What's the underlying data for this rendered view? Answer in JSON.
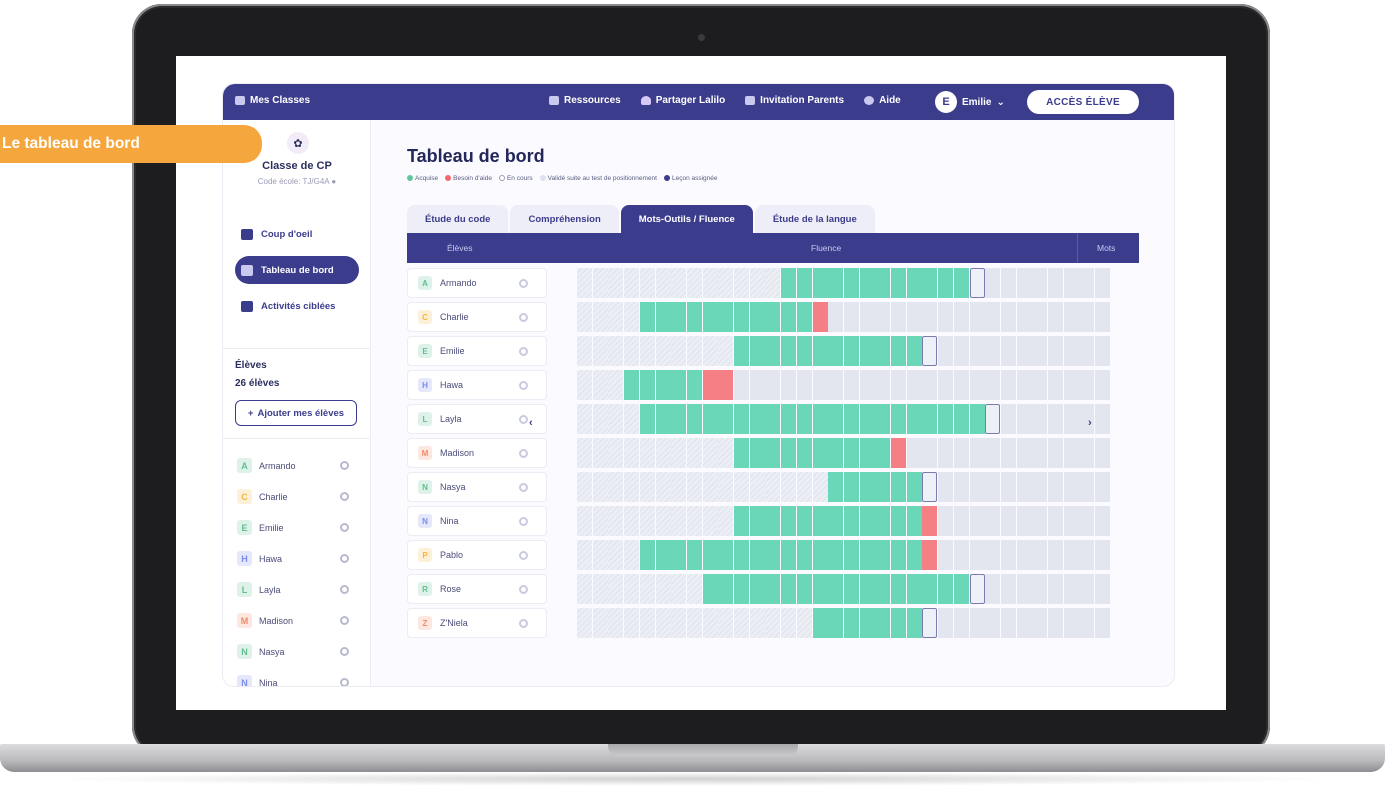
{
  "callout": {
    "text": "Le tableau de bord"
  },
  "topbar": {
    "mes_classes": "Mes Classes",
    "nav": [
      {
        "label": "Ressources",
        "icon": "book-icon"
      },
      {
        "label": "Partager Lalilo",
        "icon": "heart-icon"
      },
      {
        "label": "Invitation Parents",
        "icon": "mail-icon"
      },
      {
        "label": "Aide",
        "icon": "help-icon"
      }
    ],
    "user_name": "Emilie",
    "acces_eleve": "ACCÈS ÉLÈVE"
  },
  "sidebar": {
    "class_name": "Classe de CP",
    "class_code": "Code école: TJ/G4A",
    "nav": [
      {
        "label": "Coup d'oeil",
        "active": false
      },
      {
        "label": "Tableau de bord",
        "active": true
      },
      {
        "label": "Activités ciblées",
        "active": false
      }
    ],
    "eleves_title": "Élèves",
    "eleves_count": "26 élèves",
    "add_button": "Ajouter mes élèves",
    "students": [
      {
        "name": "Armando",
        "letter": "A",
        "color": "#5fbf8f"
      },
      {
        "name": "Charlie",
        "letter": "C",
        "color": "#f3b63c"
      },
      {
        "name": "Emilie",
        "letter": "E",
        "color": "#5fbf8f"
      },
      {
        "name": "Hawa",
        "letter": "H",
        "color": "#7a8ee6"
      },
      {
        "name": "Layla",
        "letter": "L",
        "color": "#5fbf8f"
      },
      {
        "name": "Madison",
        "letter": "M",
        "color": "#f28a6a"
      },
      {
        "name": "Nasya",
        "letter": "N",
        "color": "#5fbf8f"
      },
      {
        "name": "Nina",
        "letter": "N",
        "color": "#7a8ee6"
      }
    ]
  },
  "main": {
    "title": "Tableau de bord",
    "legend": [
      {
        "label": "Acquise",
        "color": "#5fc79c"
      },
      {
        "label": "Besoin d'aide",
        "color": "#f06b6b"
      },
      {
        "label": "En cours",
        "color": "#ffffff"
      },
      {
        "label": "Validé suite au test de positionnement",
        "color": "#dfe2ec"
      },
      {
        "label": "Leçon assignée",
        "color": "#3c3c8c"
      }
    ],
    "tabs": [
      {
        "label": "Étude du code",
        "active": false
      },
      {
        "label": "Compréhension",
        "active": false
      },
      {
        "label": "Mots-Outils / Fluence",
        "active": true
      },
      {
        "label": "Étude de la langue",
        "active": false
      }
    ],
    "grid_header": {
      "eleves": "Élèves",
      "fluence": "Fluence",
      "mots": "Mots"
    },
    "students": [
      {
        "name": "Armando",
        "letter": "A",
        "color": "#5fbf8f",
        "hatch_to": 13,
        "green_to": 25,
        "red": [],
        "cur": 25
      },
      {
        "name": "Charlie",
        "letter": "C",
        "color": "#f3b63c",
        "hatch_to": 4,
        "green_to": 15,
        "red": [
          15
        ],
        "cur": null
      },
      {
        "name": "Emilie",
        "letter": "E",
        "color": "#5fbf8f",
        "hatch_to": 10,
        "green_to": 22,
        "red": [],
        "cur": 22
      },
      {
        "name": "Hawa",
        "letter": "H",
        "color": "#7a8ee6",
        "hatch_to": 3,
        "green_to": 8,
        "red": [
          8,
          9
        ],
        "cur": null
      },
      {
        "name": "Layla",
        "letter": "L",
        "color": "#5fbf8f",
        "hatch_to": 4,
        "green_to": 26,
        "red": [],
        "cur": 26
      },
      {
        "name": "Madison",
        "letter": "M",
        "color": "#f28a6a",
        "hatch_to": 10,
        "green_to": 20,
        "red": [
          20
        ],
        "cur": null
      },
      {
        "name": "Nasya",
        "letter": "N",
        "color": "#5fbf8f",
        "hatch_to": 16,
        "green_to": 22,
        "red": [],
        "cur": 22
      },
      {
        "name": "Nina",
        "letter": "N",
        "color": "#7a8ee6",
        "hatch_to": 10,
        "green_to": 22,
        "red": [
          22
        ],
        "cur": null
      },
      {
        "name": "Pablo",
        "letter": "P",
        "color": "#f3b63c",
        "hatch_to": 4,
        "green_to": 22,
        "red": [
          22
        ],
        "cur": null
      },
      {
        "name": "Rose",
        "letter": "R",
        "color": "#5fbf8f",
        "hatch_to": 8,
        "green_to": 25,
        "red": [],
        "cur": 25
      },
      {
        "name": "Z'Niela",
        "letter": "Z",
        "color": "#f28a6a",
        "hatch_to": 15,
        "green_to": 22,
        "red": [],
        "cur": 22
      }
    ]
  }
}
